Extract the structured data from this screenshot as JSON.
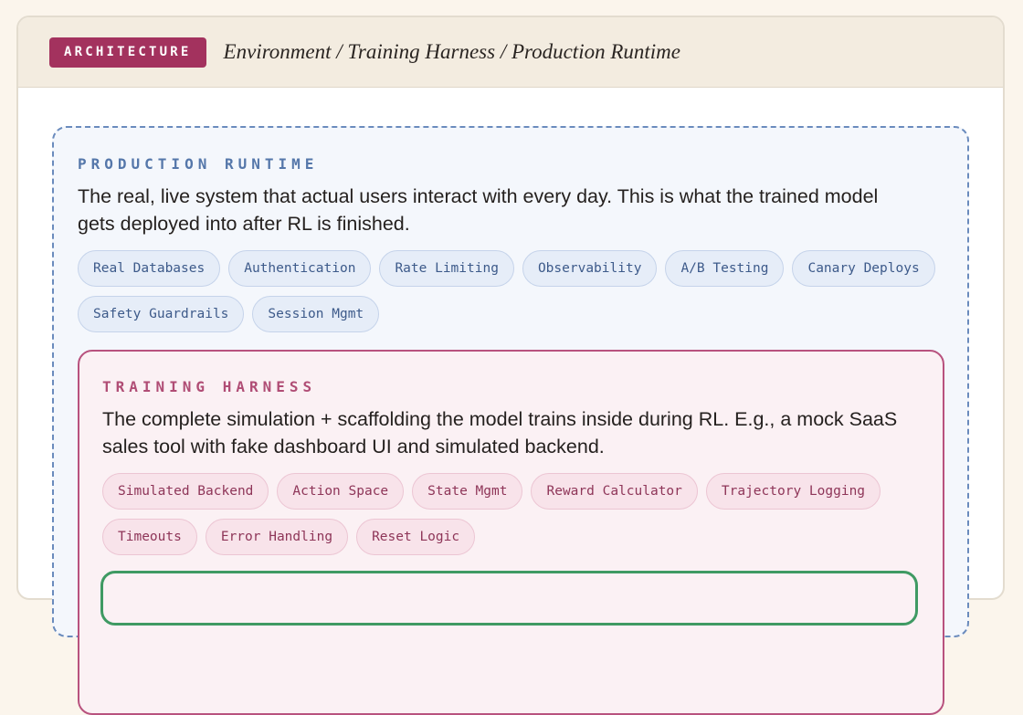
{
  "header": {
    "badge": "ARCHITECTURE",
    "title": "Environment / Training Harness / Production Runtime"
  },
  "production": {
    "label": "PRODUCTION RUNTIME",
    "description": "The real, live system that actual users interact with every day. This is what the trained model gets deployed into after RL is finished.",
    "chips": [
      "Real Databases",
      "Authentication",
      "Rate Limiting",
      "Observability",
      "A/B Testing",
      "Canary Deploys",
      "Safety Guardrails",
      "Session Mgmt"
    ]
  },
  "training": {
    "label": "TRAINING HARNESS",
    "description": "The complete simulation + scaffolding the model trains inside during RL. E.g., a mock SaaS sales tool with fake dashboard UI and simulated backend.",
    "chips": [
      "Simulated Backend",
      "Action Space",
      "State Mgmt",
      "Reward Calculator",
      "Trajectory Logging",
      "Timeouts",
      "Error Handling",
      "Reset Logic"
    ]
  },
  "colors": {
    "badge": "#a3325e",
    "production_border": "#6a8bbd",
    "training_border": "#b8527e",
    "environment_border": "#3f9a63"
  }
}
